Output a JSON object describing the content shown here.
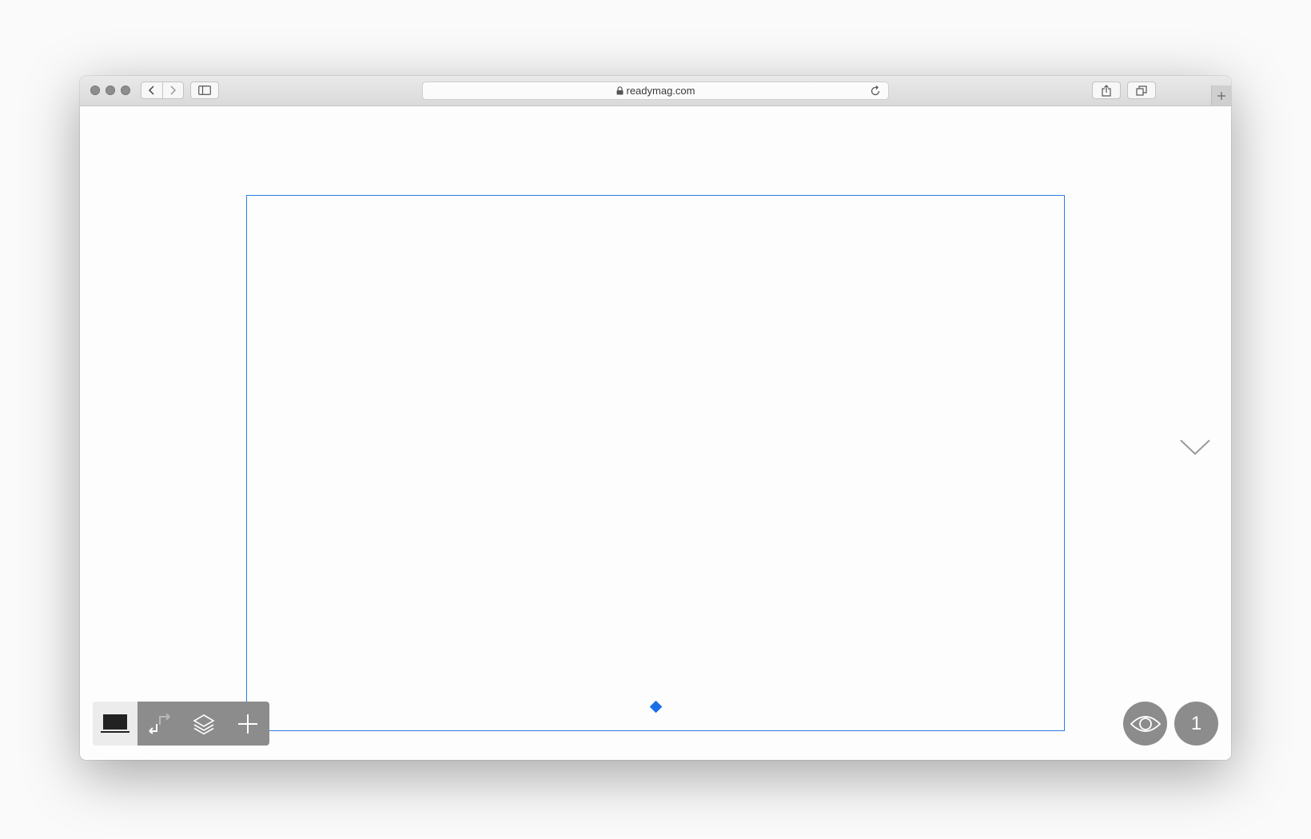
{
  "browser": {
    "url": "readymag.com",
    "icons": {
      "back": "chevron-left-icon",
      "forward": "chevron-right-icon",
      "sidebar": "sidebar-icon",
      "lock": "lock-icon",
      "reload": "reload-icon",
      "share": "share-icon",
      "tabs": "tabs-icon",
      "new_tab": "plus-icon"
    }
  },
  "editor": {
    "frame_color": "#2a7de1",
    "handle_color": "#1a6fe8",
    "toolbar": {
      "tools": [
        "laptop-icon",
        "link-arrows-icon",
        "layers-icon",
        "plus-icon"
      ]
    },
    "preview_icon": "eye-icon",
    "page_number": "1"
  }
}
